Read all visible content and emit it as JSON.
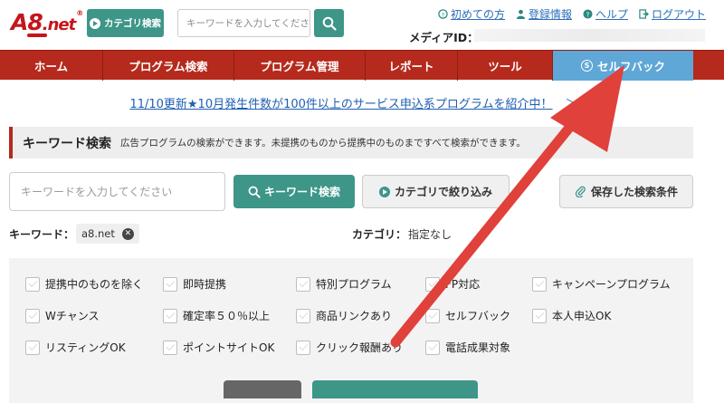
{
  "colors": {
    "brand_red": "#c4161c",
    "nav_red": "#b52a1c",
    "teal": "#3d9688",
    "active_blue": "#5fa7d6",
    "link_blue": "#2a6ebb",
    "annotation_arrow": "#e0413a"
  },
  "header": {
    "logo_main": "A8",
    "logo_suffix": ".net",
    "logo_reg": "®",
    "category_button": "カテゴリ検索",
    "search_placeholder": "キーワードを入力してください",
    "links": [
      {
        "icon": "help-circle-icon",
        "label": "初めての方"
      },
      {
        "icon": "user-icon",
        "label": "登録情報"
      },
      {
        "icon": "question-icon",
        "label": "ヘルプ"
      },
      {
        "icon": "logout-icon",
        "label": "ログアウト"
      }
    ],
    "media_id_label": "メディアID："
  },
  "nav": {
    "items": [
      {
        "label": "ホーム"
      },
      {
        "label": "プログラム検索"
      },
      {
        "label": "プログラム管理"
      },
      {
        "label": "レポート"
      },
      {
        "label": "ツール"
      },
      {
        "label": "セルフバック",
        "icon": "selfback-icon",
        "active": true
      }
    ]
  },
  "notice": {
    "text": "11/10更新★10月発生件数が100件以上のサービス申込系プログラムを紹介中！",
    "arrows": "＞＞"
  },
  "keyword_section": {
    "title": "キーワード検索",
    "description": "広告プログラムの検索ができます。未提携のものから提携中のものまですべて検索ができます。",
    "input_placeholder": "キーワードを入力してください",
    "search_button": "キーワード検索",
    "category_filter_button": "カテゴリで絞り込み",
    "saved_conditions_button": "保存した検索条件",
    "keyword_label": "キーワード：",
    "keyword_tag": "a8.net",
    "category_label": "カテゴリ：",
    "category_value": "指定なし"
  },
  "options": [
    {
      "label": "提携中のものを除く"
    },
    {
      "label": "即時提携"
    },
    {
      "label": "特別プログラム"
    },
    {
      "label": "FP対応"
    },
    {
      "label": "キャンペーンプログラム"
    },
    {
      "label": "Wチャンス"
    },
    {
      "label": "確定率５０％以上"
    },
    {
      "label": "商品リンクあり"
    },
    {
      "label": "セルフバック"
    },
    {
      "label": "本人申込OK"
    },
    {
      "label": "リスティングOK"
    },
    {
      "label": "ポイントサイトOK"
    },
    {
      "label": "クリック報酬あり"
    },
    {
      "label": "電話成果対象"
    }
  ]
}
